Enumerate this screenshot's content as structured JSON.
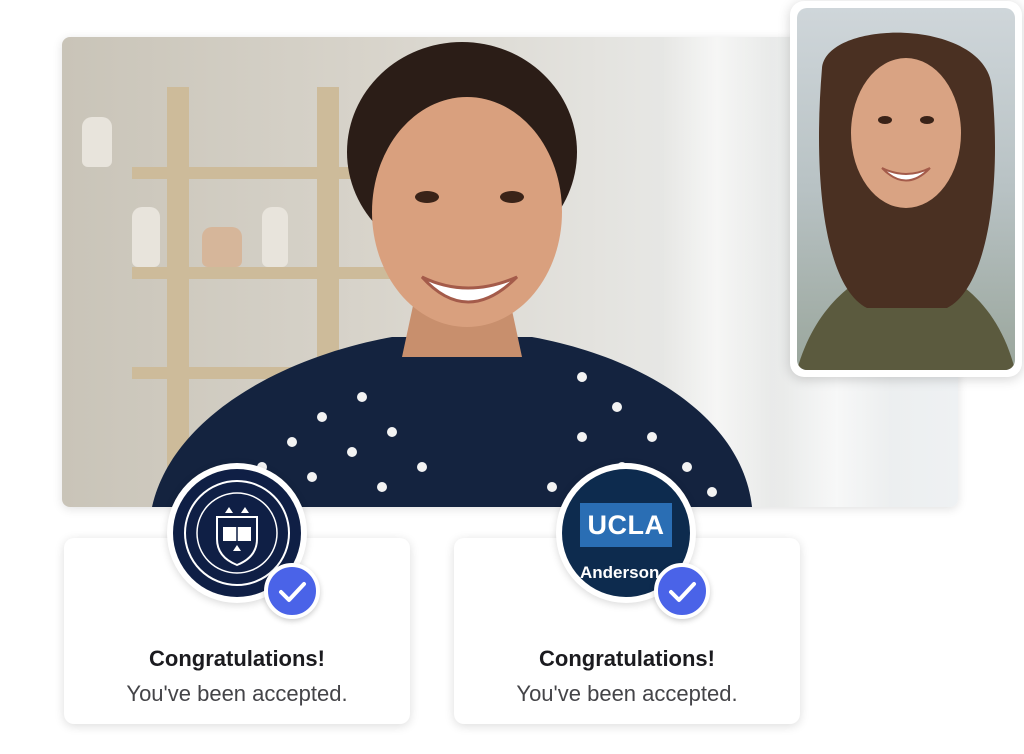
{
  "cards": [
    {
      "title": "Congratulations!",
      "subtitle": "You've been accepted.",
      "logo": "university-of-oxford-crest"
    },
    {
      "title": "Congratulations!",
      "subtitle": "You've been accepted.",
      "logo_text": "UCLA",
      "logo_subtext": "Anderson"
    }
  ],
  "colors": {
    "check_badge": "#4a63e8",
    "oxford_navy": "#0f1f45",
    "ucla_blue": "#2a6eb4",
    "ucla_navy": "#0d2b4e"
  }
}
